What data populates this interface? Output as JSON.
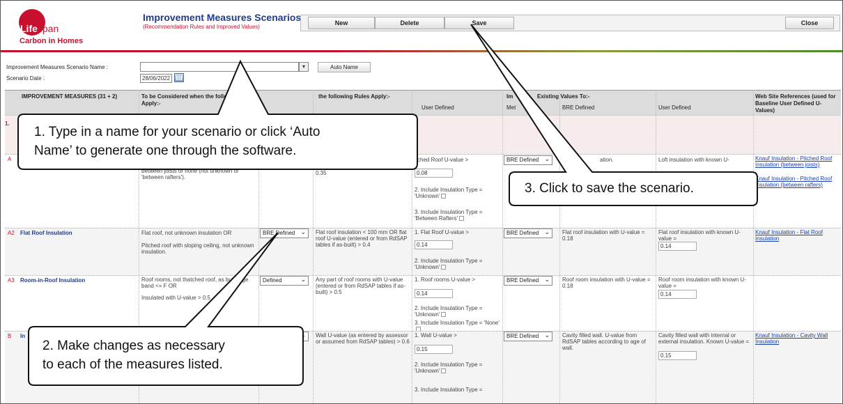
{
  "header": {
    "logo": {
      "word_a": "Life",
      "word_b": "span",
      "subtitle": "Carbon in Homes"
    },
    "title": "Improvement Measures Scenarios",
    "subtitle": "(Recommendation Rules and Improved Values)",
    "buttons": {
      "new": "New",
      "delete": "Delete",
      "save": "Save",
      "close": "Close"
    }
  },
  "form": {
    "name_label": "Improvement Measures Scenario Name :",
    "name_value": "",
    "auto_name": "Auto Name",
    "date_label": "Scenario Date :",
    "date_value": "28/06/2022"
  },
  "table": {
    "headers": {
      "measures": "IMPROVEMENT MEASURES (31 + 2)",
      "considered": "To be Considered when the following Rules Apply:-",
      "rules": "the following Rules Apply:-",
      "existing": "Im",
      "existing2": "Existing Values To:-",
      "web": "Web Site References (used for Baseline User Defined U-Values)",
      "user_defined": "User Defined",
      "met": "Met",
      "bre_defined": "BRE Defined",
      "user_defined2": "User Defined"
    },
    "band_label": "1.",
    "rows": [
      {
        "code": "A",
        "considered": "between joists or none (not unknown or 'between rafters').",
        "rule": "0.35",
        "ud1": "itched Roof U-value >",
        "ud1_val": "0.08",
        "ud2": "2. Include Insulation Type = 'Unknown'",
        "ud3": "3. Include Insulation Type = 'Between Rafters'",
        "method": "BRE Defined",
        "bre": "ation.",
        "user": "Loft insulation with known U-",
        "links": [
          "Knauf Insulation - Pitched Roof Insulation (between joists)",
          "Knauf Insulation - Pitched Roof Insulation (between rafters)"
        ]
      },
      {
        "code": "A2",
        "name": "Flat Roof Insulation",
        "considered1": "Flat roof, not unknown insulation OR",
        "considered2": "Pitched roof with sloping ceiling, not unknown insulation.",
        "select": "BRE Defined",
        "rule": "Flat roof insulation < 100 mm OR flat roof U-value (entered or from RdSAP tables if as-built) > 0.4",
        "ud1": "1. Flat Roof U-value >",
        "ud1_val": "0.14",
        "ud2": "2. Include Insulation Type = 'Unknown'",
        "method": "BRE Defined",
        "bre": "Flat roof insulation with U-value = 0.18",
        "user": "Flat roof insulation with known U-value =",
        "user_val": "0.14",
        "links": [
          "Knauf Insulation - Flat Roof Insulation"
        ]
      },
      {
        "code": "A3",
        "name": "Room-in-Roof Insulation",
        "considered1": "Roof rooms, not thatched roof, as built, age band <= F OR",
        "considered2": "Insulated with U-value > 0.5",
        "select": "Defined",
        "rule": "Any part of roof rooms with U-value (entered or from RdSAP tables if as-built) > 0.5",
        "ud1": "1. Roof rooms U-value >",
        "ud1_val": "0.14",
        "ud2": "2. Include Insulation Type = 'Unknown'",
        "ud3": "3. Include Insulation Type = 'None'",
        "method": "BRE Defined",
        "bre": "Roof room insulation with U-value = 0.18",
        "user": "Roof room insulation with known U-value =",
        "user_val": "0.14"
      },
      {
        "code": "B",
        "name": "In",
        "rule": "Wall U-value (as entered by assessor or assumed from RdSAP tables) > 0.6",
        "ud1": "1. Wall U-value >",
        "ud1_val": "0.15",
        "ud2": "2. Include Insulation Type = 'Unknown'",
        "ud3": "3. Include Insulation Type =",
        "method": "BRE Defined",
        "bre": "Cavity filled wall. U-value from RdSAP tables according to age of wall.",
        "user": "Cavity filled wall with internal or external insulation. Known U-value =",
        "user_val": "0.15",
        "links": [
          "Knauf Insulation - Cavity Wall Insulation"
        ]
      }
    ]
  },
  "callouts": [
    {
      "line1": "1. Type in a name for your scenario or click ‘Auto",
      "line2": "Name’ to generate one through the software."
    },
    {
      "line1": "2. Make changes as necessary",
      "line2": "to each of the measures listed."
    },
    {
      "line1": "3. Click to save the scenario."
    }
  ],
  "colors": {
    "brand_red": "#c8102e",
    "title_blue": "#1f3c88",
    "link_blue": "#1a3fb0"
  }
}
